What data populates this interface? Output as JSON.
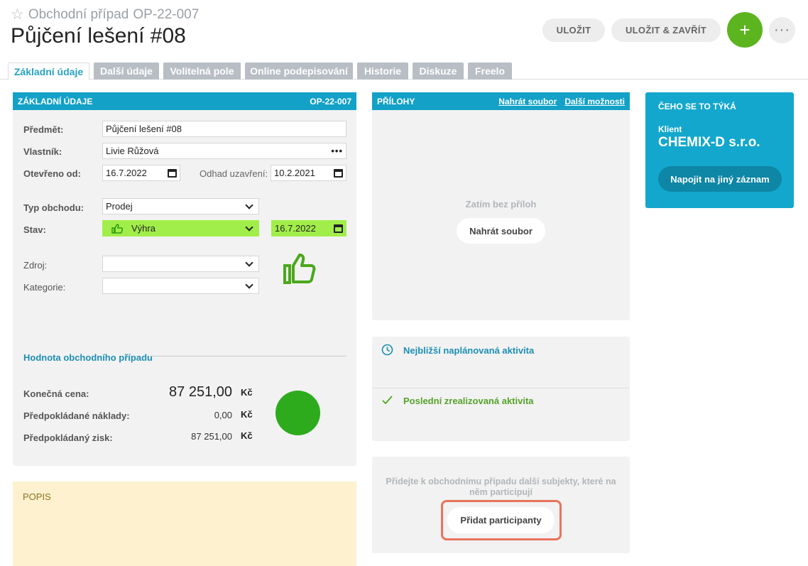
{
  "header": {
    "record_type": "Obchodní případ",
    "record_code": "OP-22-007",
    "title": "Půjčení lešení #08",
    "save_label": "ULOŽIT",
    "save_close_label": "ULOŽIT & ZAVŘÍT",
    "add_label": "+",
    "more_label": "···"
  },
  "tabs": [
    {
      "label": "Základní údaje",
      "active": true
    },
    {
      "label": "Další údaje"
    },
    {
      "label": "Volitelná pole"
    },
    {
      "label": "Online podepisování"
    },
    {
      "label": "Historie"
    },
    {
      "label": "Diskuze"
    },
    {
      "label": "Freelo"
    }
  ],
  "basic": {
    "heading": "ZÁKLADNÍ ÚDAJE",
    "code": "OP-22-007",
    "subject_label": "Předmět:",
    "subject_value": "Půjčení lešení #08",
    "owner_label": "Vlastník:",
    "owner_value": "Livie Růžová",
    "owner_more": "•••",
    "opened_label": "Otevřeno od:",
    "opened_value": "16.7.2022",
    "close_est_label": "Odhad uzavření:",
    "close_est_value": "10.2.2021",
    "type_label": "Typ obchodu:",
    "type_value": "Prodej",
    "state_label": "Stav:",
    "state_value": "Výhra",
    "state_date": "16.7.2022",
    "source_label": "Zdroj:",
    "source_value": "",
    "category_label": "Kategorie:",
    "category_value": ""
  },
  "value_section": {
    "heading": "Hodnota obchodního případu",
    "final_label": "Konečná cena:",
    "final_value": "87 251,00",
    "costs_label": "Předpokládané náklady:",
    "costs_value": "0,00",
    "profit_label": "Předpokládaný zisk:",
    "profit_value": "87 251,00",
    "currency": "Kč",
    "indicator_color": "#2eab1d"
  },
  "popis": {
    "heading": "POPIS"
  },
  "attachments": {
    "heading": "PŘÍLOHY",
    "upload_link": "Nahrát soubor",
    "more_link": "Další možnosti",
    "empty_text": "Zatím bez příloh",
    "upload_button": "Nahrát soubor"
  },
  "activities": {
    "next_label": "Nejbližší naplánovaná aktivita",
    "last_label": "Poslední zrealizovaná aktivita"
  },
  "participants": {
    "text": "Přidejte k obchodnímu případu další subjekty, které na něm participují",
    "button": "Přidat participanty"
  },
  "related": {
    "heading": "ČEHO SE TO TÝKÁ",
    "client_label": "Klient",
    "client_name": "CHEMIX-D s.r.o.",
    "relink_button": "Napojit na jiný záznam"
  },
  "colors": {
    "accent": "#13a1c7",
    "win_green": "#a1ee4a",
    "add_green": "#5cb41e",
    "highlight": "#e9735c"
  }
}
